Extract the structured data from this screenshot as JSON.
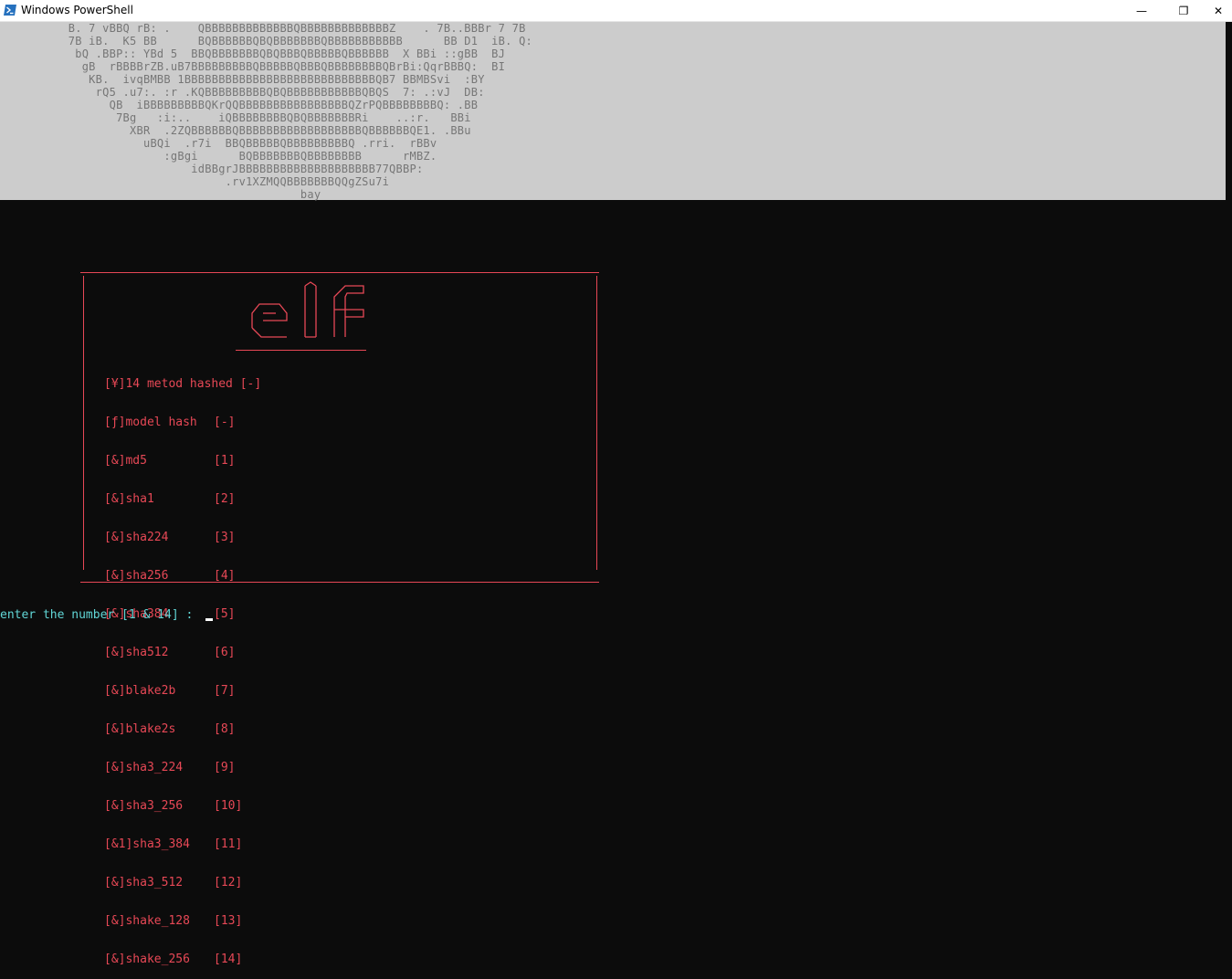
{
  "window": {
    "title": "Windows PowerShell",
    "minimize_glyph": "—",
    "restore_glyph": "❐",
    "close_glyph": "✕",
    "icon": "powershell-icon"
  },
  "ascii_art": "          B. 7 vBBQ rB: .    QBBBBBBBBBBBBBQBBBBBBBBBBBBBZ    . 7B..BBBr 7 7B\n          7B iB.  K5 BB      BQBBBBBBQBQBBBBBBBQBBBBBBBBBBB      BB D1  iB. Q:\n           bQ .BBP:: YBd 5  BBQBBBBBBBQBQBBBQBBBBBQBBBBBB  X BBi ::gBB  BJ\n            gB  rBBBBrZB.uB7BBBBBBBBBQBBBBBQBBBQBBBBBBBBQBrBi:QqrBBBQ:  BI\n             KB.  ivqBMBB 1BBBBBBBBBBBBBBBBBBBBBBBBBBBBQB7 BBMBSvi  :BY\n              rQ5 .u7:. :r .KQBBBBBBBBBQBQBBBBBBBBBBBQBQS  7: .:vJ  DB:\n                QB  iBBBBBBBBBQKrQQBBBBBBBBBBBBBBBBQZrPQBBBBBBBBQ: .BB\n                 7Bg   :i:..    iQBBBBBBBBQBQBBBBBBBRi    ..:r.   BBi\n                   XBR  .2ZQBBBBBBQBBBBBBBBBBBBBBBBBBQBBBBBBQE1. .BBu\n                     uBQi  .r7i  BBQBBBBBQBBBBBBBBBQ .rri.  rBBv\n                        :gBgi      BQBBBBBBBQBBBBBBBB      rMBZ.\n                            idBBgrJBBBBBBBBBBBBBBBBBBBB77QBBP:\n                                 .rv1XZMQQBBBBBBBQQgZSu7i\n                                            bay",
  "logo_art": "        _   __\n       | | / _|\n  ___  | || |_\n / _ \\ | ||  _|\n|  __/ | || |\n \\___| |_||_|",
  "menu": {
    "header": "[¥]14 metod hashed [-]",
    "subheader": {
      "label": "[ƒ]model hash",
      "code": "[-]"
    },
    "items": [
      {
        "label": "[&]md5",
        "code": "[1]"
      },
      {
        "label": "[&]sha1",
        "code": "[2]"
      },
      {
        "label": "[&]sha224",
        "code": "[3]"
      },
      {
        "label": "[&]sha256",
        "code": "[4]"
      },
      {
        "label": "[&]sha384",
        "code": "[5]"
      },
      {
        "label": "[&]sha512",
        "code": "[6]"
      },
      {
        "label": "[&]blake2b",
        "code": "[7]"
      },
      {
        "label": "[&]blake2s",
        "code": "[8]"
      },
      {
        "label": "[&]sha3_224",
        "code": "[9]"
      },
      {
        "label": "[&]sha3_256",
        "code": "[10]"
      },
      {
        "label": "[&1]sha3_384",
        "code": "[11]"
      },
      {
        "label": "[&]sha3_512",
        "code": "[12]"
      },
      {
        "label": "[&]shake_128",
        "code": "[13]"
      },
      {
        "label": "[&]shake_256",
        "code": "[14]"
      }
    ]
  },
  "prompt": "enter the number [1 & 14] : ",
  "colors": {
    "terminal_bg": "#0c0c0c",
    "selection_bg": "#cccccc",
    "art_text": "#767676",
    "menu_red": "#e74856",
    "prompt_cyan": "#61d6d6"
  }
}
